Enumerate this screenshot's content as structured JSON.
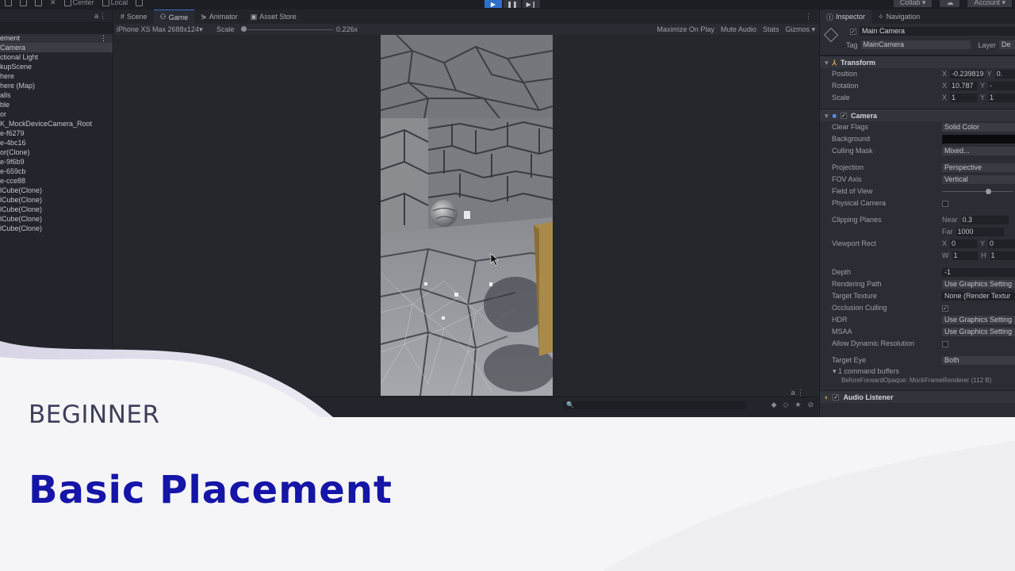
{
  "toolbar": {
    "center_label": "Center",
    "local_label": "Local",
    "collab_label": "Collab",
    "account_label": "Account",
    "play_icon": "▶",
    "pause_icon": "❚❚",
    "step_icon": "▶❙"
  },
  "hierarchy": {
    "scene_label": "ement",
    "items": [
      "Camera",
      "ctional Light",
      "kupScene",
      "here",
      "here (Map)",
      "alls",
      "ble",
      "or",
      "K_MockDeviceCamera_Root",
      "e-f6279",
      "e-4bc16",
      "or(Clone)",
      "e-9f6b9",
      "e-659cb",
      "e-cce88",
      "lCube(Clone)",
      "lCube(Clone)",
      "lCube(Clone)",
      "lCube(Clone)",
      "lCube(Clone)"
    ]
  },
  "center": {
    "tabs": [
      "Scene",
      "Game",
      "Animator",
      "Asset Store"
    ],
    "resolution": "iPhone XS Max 2688x124",
    "scale_label": "Scale",
    "scale_value": "0.226x",
    "maximize_on_play": "Maximize On Play",
    "mute_audio": "Mute Audio",
    "stats": "Stats",
    "gizmos": "Gizmos"
  },
  "inspector": {
    "tabs": [
      "Inspector",
      "Navigation"
    ],
    "object_name": "Main Camera",
    "tag_label": "Tag",
    "tag_value": "MainCamera",
    "layer_label": "Layer",
    "layer_value": "De",
    "transform": {
      "title": "Transform",
      "position_label": "Position",
      "position_x": "-0.239819",
      "position_y": "0.",
      "rotation_label": "Rotation",
      "rotation_x": "10.787",
      "rotation_y": "-",
      "scale_label": "Scale",
      "scale_x": "1",
      "scale_y": "1"
    },
    "camera": {
      "title": "Camera",
      "clear_flags_label": "Clear Flags",
      "clear_flags": "Solid Color",
      "background_label": "Background",
      "culling_mask_label": "Culling Mask",
      "culling_mask": "Mixed...",
      "projection_label": "Projection",
      "projection": "Perspective",
      "fov_axis_label": "FOV Axis",
      "fov_axis": "Vertical",
      "field_of_view_label": "Field of View",
      "physical_camera_label": "Physical Camera",
      "clipping_planes_label": "Clipping Planes",
      "near_label": "Near",
      "near": "0.3",
      "far_label": "Far",
      "far": "1000",
      "viewport_rect_label": "Viewport Rect",
      "vr_x": "0",
      "vr_y": "0",
      "vr_w": "1",
      "vr_h": "1",
      "depth_label": "Depth",
      "depth": "-1",
      "rendering_path_label": "Rendering Path",
      "rendering_path": "Use Graphics Setting",
      "target_texture_label": "Target Texture",
      "target_texture": "None (Render Textur",
      "occlusion_culling_label": "Occlusion Culling",
      "hdr_label": "HDR",
      "hdr": "Use Graphics Setting",
      "msaa_label": "MSAA",
      "msaa": "Use Graphics Setting",
      "allow_dynamic_resolution_label": "Allow Dynamic Resolution",
      "target_eye_label": "Target Eye",
      "target_eye": "Both",
      "command_buffers": "1 command buffers",
      "command_buffer_detail": "BeforeForwardOpaque: MockFrameRenderer (112 B)"
    },
    "audio_listener": "Audio Listener"
  },
  "card": {
    "level": "BEGINNER",
    "title": "Basic Placement"
  },
  "colors": {
    "title_blue": "#1515a8",
    "level_gray": "#3e3f59",
    "play_blue": "#2f6fd0"
  }
}
